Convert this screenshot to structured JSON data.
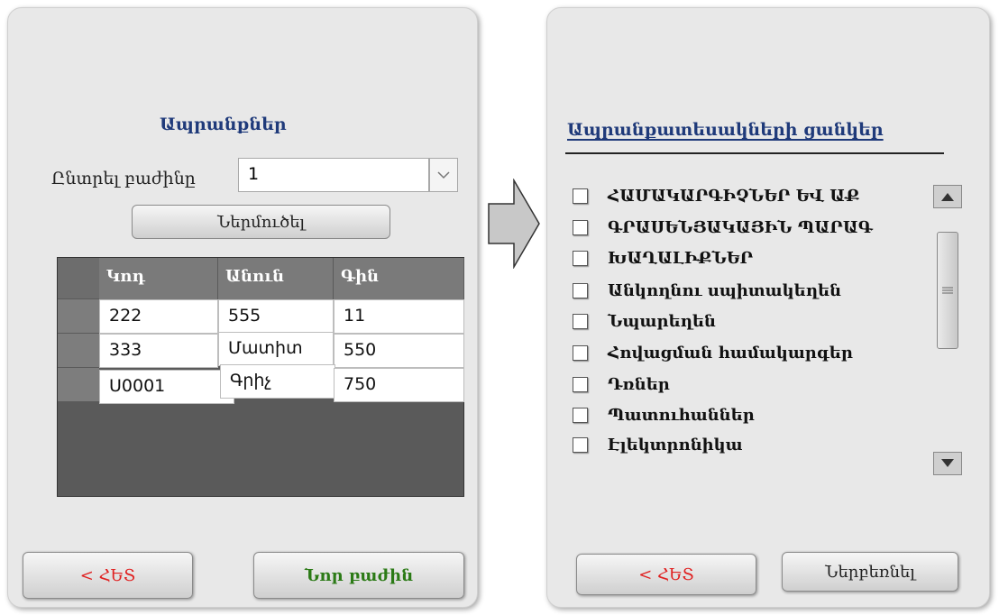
{
  "left": {
    "title": "Ապրանքներ",
    "choose_label": "Ընտրել բաժինը",
    "part_value": "1",
    "load_button": "Ներմուծել",
    "grid": {
      "columns": [
        "Կոդ",
        "Անուն",
        "Գին"
      ],
      "rows": [
        [
          "222",
          "555",
          "11"
        ],
        [
          "333",
          "Մատիտ",
          "550"
        ],
        [
          "U0001",
          "Գրիչ",
          "750"
        ]
      ]
    },
    "back_button": "< ՀԵՏ",
    "new_part_button": "Նոր բաժին"
  },
  "right": {
    "title": "Ապրանքատեսակների ցանկեր",
    "items": [
      "ՀԱՄԱԿԱՐԳԻՉՆԵՐ ԵՎ ԱՔ",
      "ԳՐԱՍԵՆՅԱԿԱՅԻՆ ՊԱՐԱԳ",
      "ԽԱՂԱԼԻՔՆԵՐ",
      "Անկողնու սպիտակեղեն",
      "Նպարեղեն",
      "Հովացման համակարգեր",
      "Դռներ",
      "Պատուհաններ",
      "Էլեկտրոնիկա"
    ],
    "back_button": "< ՀԵՏ",
    "select_button": "Ներբեռնել"
  },
  "colors": {
    "title": "#1f3a7a",
    "back": "#e02020",
    "new_part": "#2b7a16"
  }
}
